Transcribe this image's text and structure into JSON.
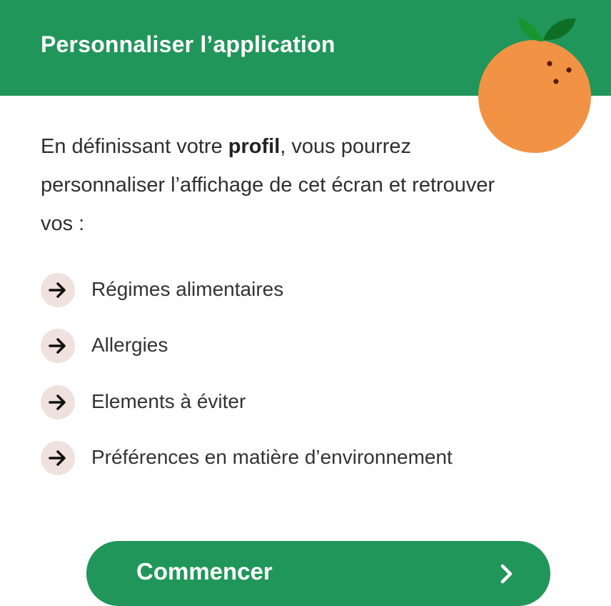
{
  "header": {
    "title": "Personnaliser l’application",
    "illustration": "orange-fruit-icon",
    "background_color": "#21965a"
  },
  "intro": {
    "text_before": "En définissant votre ",
    "bold": "profil",
    "text_after": ", vous pourrez personnaliser l’affichage de cet écran et retrouver vos :"
  },
  "list": {
    "icon": "arrow-right-icon",
    "items": [
      {
        "label": "Régimes alimentaires"
      },
      {
        "label": "Allergies"
      },
      {
        "label": "Elements à éviter"
      },
      {
        "label": "Préférences en matière d’environnement"
      }
    ]
  },
  "cta": {
    "label": "Commencer",
    "icon": "chevron-right-icon"
  },
  "colors": {
    "accent": "#21965a",
    "orange": "#f29245",
    "leaf": "#159030",
    "bullet_bg": "#efe1dd"
  }
}
